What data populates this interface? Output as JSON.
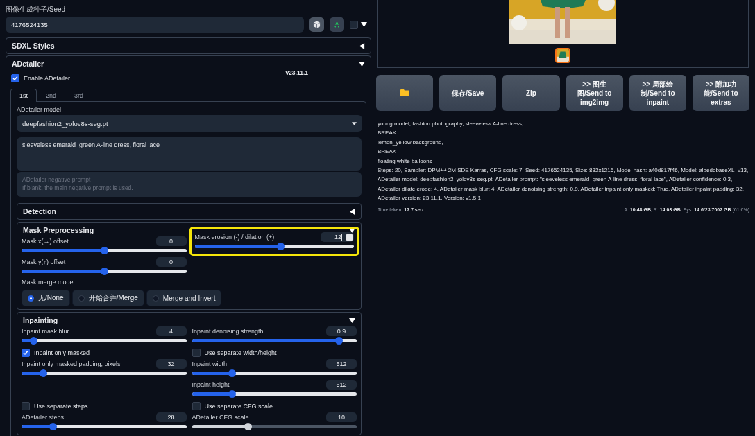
{
  "seed": {
    "label": "图像生成种子/Seed",
    "value": "4176524135",
    "extra_checked": false
  },
  "sdxl_styles": {
    "title": "SDXL Styles",
    "expanded": false
  },
  "adetailer": {
    "title": "ADetailer",
    "expanded": true,
    "enable": {
      "label": "Enable ADetailer",
      "checked": true
    },
    "version": "v23.11.1",
    "tabs": [
      {
        "label": "1st",
        "selected": true
      },
      {
        "label": "2nd",
        "selected": false
      },
      {
        "label": "3rd",
        "selected": false
      }
    ],
    "model": {
      "label": "ADetailer model",
      "value": "deepfashion2_yolov8s-seg.pt"
    },
    "prompt": {
      "value": "sleeveless emerald_green A-line dress, floral lace"
    },
    "negative_prompt": {
      "placeholder": "ADetailer negative prompt\nIf blank, the main negative prompt is used."
    },
    "detection": {
      "title": "Detection",
      "expanded": false
    },
    "mask_preprocessing": {
      "title": "Mask Preprocessing",
      "expanded": true,
      "left": [
        {
          "label": "Mask x(→) offset",
          "value": "0",
          "level": 0.5,
          "disabled": false,
          "focused": false,
          "highlighted": false
        },
        {
          "label": "Mask y(↑) offset",
          "value": "0",
          "level": 0.5,
          "disabled": false,
          "focused": false,
          "highlighted": false
        }
      ],
      "right": [
        {
          "label": "Mask erosion (-) / dilation (+)",
          "value": "12",
          "level": 0.54,
          "disabled": false,
          "focused": true,
          "highlighted": true
        }
      ],
      "merge_mode": {
        "label": "Mask merge mode",
        "options": [
          {
            "label": "无/None",
            "selected": true
          },
          {
            "label": "开始合并/Merge",
            "selected": false
          },
          {
            "label": "Merge and Invert",
            "selected": false
          }
        ]
      }
    },
    "inpainting": {
      "title": "Inpainting",
      "expanded": true,
      "rows": [
        {
          "left": {
            "kind": "slider",
            "label": "Inpaint mask blur",
            "value": "4",
            "level": 0.07,
            "disabled": false
          },
          "right": {
            "kind": "slider",
            "label": "Inpaint denoising strength",
            "value": "0.9",
            "level": 0.89,
            "disabled": false
          }
        },
        {
          "left": {
            "kind": "checkbox",
            "label": "Inpaint only masked",
            "checked": true
          },
          "right": {
            "kind": "checkbox",
            "label": "Use separate width/height",
            "checked": false
          }
        },
        {
          "left": {
            "kind": "slider",
            "label": "Inpaint only masked padding, pixels",
            "value": "32",
            "level": 0.13,
            "disabled": false
          },
          "right": {
            "kind": "slider",
            "label": "Inpaint width",
            "value": "512",
            "level": 0.24,
            "disabled": false
          }
        },
        {
          "right": {
            "kind": "slider",
            "label": "Inpaint height",
            "value": "512",
            "level": 0.24,
            "disabled": false
          }
        },
        {
          "left": {
            "kind": "checkbox",
            "label": "Use separate steps",
            "checked": false
          },
          "right": {
            "kind": "checkbox",
            "label": "Use separate CFG scale",
            "checked": false
          }
        },
        {
          "left": {
            "kind": "slider",
            "label": "ADetailer steps",
            "value": "28",
            "level": 0.19,
            "disabled": false
          },
          "right": {
            "kind": "slider",
            "label": "ADetailer CFG scale",
            "value": "10",
            "level": 0.34,
            "disabled": true
          }
        }
      ]
    }
  },
  "gallery": {
    "image": {
      "kind": "picture"
    },
    "thumbnail": {
      "kind": "picture",
      "selected": true
    }
  },
  "actions": [
    {
      "kind": "folder"
    },
    {
      "kind": "text",
      "label": "保存/Save"
    },
    {
      "kind": "text",
      "label": "Zip"
    },
    {
      "kind": "text",
      "label": ">> 图生图/Send to img2img"
    },
    {
      "kind": "text",
      "label": ">> 局部绘制/Send to inpaint"
    },
    {
      "kind": "text",
      "label": ">> 附加功能/Send to extras"
    }
  ],
  "info": {
    "lines": [
      "young model, fashion photography, sleeveless A-line dress,",
      "BREAK",
      "lemon_yellow background,",
      "BREAK",
      "floating white balloons",
      "Steps: 20, Sampler: DPM++ 2M SDE Karras, CFG scale: 7, Seed: 4176524135, Size: 832x1216, Model hash: a40d817f46, Model: albedobaseXL_v13, ADetailer model: deepfashion2_yolov8s-seg.pt, ADetailer prompt: \"sleeveless emerald_green A-line dress, floral lace\", ADetailer confidence: 0.3, ADetailer dilate erode: 4, ADetailer mask blur: 4, ADetailer denoising strength: 0.9, ADetailer inpaint only masked: True, ADetailer inpaint padding: 32, ADetailer version: 23.11.1, Version: v1.5.1"
    ],
    "time_taken": "Time taken: **17.7 sec.**",
    "memory": "A: **10.48 GB**, R: **14.03 GB**, Sys: **14.6/23.7002 GB** (61.6%)"
  }
}
